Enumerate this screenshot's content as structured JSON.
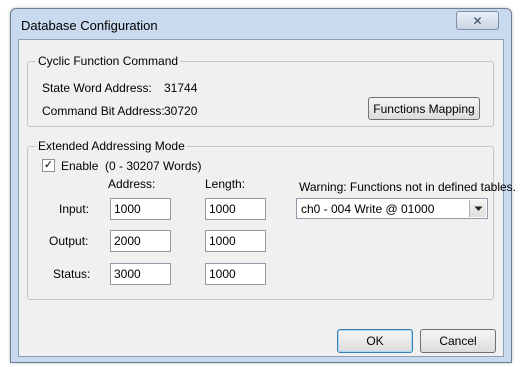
{
  "window": {
    "title": "Database Configuration",
    "close_glyph": "✕"
  },
  "cyclic": {
    "legend": "Cyclic Function Command",
    "state_word_label": "State Word Address:",
    "state_word_value": "31744",
    "command_bit_label": "Command Bit Address:",
    "command_bit_value": "30720",
    "functions_mapping_label": "Functions Mapping"
  },
  "extended": {
    "legend": "Extended Addressing Mode",
    "enable_label": "Enable",
    "enable_range": "(0 - 30207 Words)",
    "enable_checked": true,
    "address_header": "Address:",
    "length_header": "Length:",
    "rows": [
      {
        "label": "Input:",
        "address": "1000",
        "length": "1000"
      },
      {
        "label": "Output:",
        "address": "2000",
        "length": "1000"
      },
      {
        "label": "Status:",
        "address": "3000",
        "length": "1000"
      }
    ],
    "warning_text": "Warning: Functions not in defined tables.",
    "warning_selected": "ch0 - 004 Write @ 01000"
  },
  "buttons": {
    "ok_label": "OK",
    "cancel_label": "Cancel"
  },
  "icons": {
    "close": "close-icon",
    "checkmark": "checkmark-icon",
    "dropdown": "chevron-down-icon"
  },
  "colors": {
    "frame": "#c9d9ee",
    "client": "#f0f0f0",
    "default_button_border": "#3c7fb1"
  }
}
